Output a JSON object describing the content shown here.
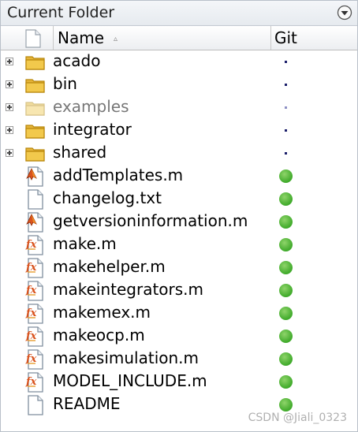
{
  "panel": {
    "title": "Current Folder"
  },
  "columns": {
    "name": "Name",
    "sort_indicator": "▵",
    "git": "Git"
  },
  "rows": [
    {
      "name": "acado",
      "type": "folder",
      "expandable": true,
      "dim": false,
      "git": "dot"
    },
    {
      "name": "bin",
      "type": "folder",
      "expandable": true,
      "dim": false,
      "git": "dot"
    },
    {
      "name": "examples",
      "type": "folder",
      "expandable": true,
      "dim": true,
      "git": "dot"
    },
    {
      "name": "integrator",
      "type": "folder",
      "expandable": true,
      "dim": false,
      "git": "dot"
    },
    {
      "name": "shared",
      "type": "folder",
      "expandable": true,
      "dim": false,
      "git": "dot"
    },
    {
      "name": "addTemplates.m",
      "type": "script",
      "expandable": false,
      "dim": false,
      "git": "green"
    },
    {
      "name": "changelog.txt",
      "type": "text",
      "expandable": false,
      "dim": false,
      "git": "green"
    },
    {
      "name": "getversioninformation.m",
      "type": "script",
      "expandable": false,
      "dim": false,
      "git": "green"
    },
    {
      "name": "make.m",
      "type": "function",
      "expandable": false,
      "dim": false,
      "git": "green"
    },
    {
      "name": "makehelper.m",
      "type": "function",
      "expandable": false,
      "dim": false,
      "git": "green"
    },
    {
      "name": "makeintegrators.m",
      "type": "function",
      "expandable": false,
      "dim": false,
      "git": "green"
    },
    {
      "name": "makemex.m",
      "type": "function",
      "expandable": false,
      "dim": false,
      "git": "green"
    },
    {
      "name": "makeocp.m",
      "type": "function",
      "expandable": false,
      "dim": false,
      "git": "green"
    },
    {
      "name": "makesimulation.m",
      "type": "function",
      "expandable": false,
      "dim": false,
      "git": "green"
    },
    {
      "name": "MODEL_INCLUDE.m",
      "type": "function",
      "expandable": false,
      "dim": false,
      "git": "green"
    },
    {
      "name": "README",
      "type": "text",
      "expandable": false,
      "dim": false,
      "git": "green"
    }
  ],
  "watermark": "CSDN @Jiali_0323",
  "colors": {
    "git_clean": "#3faa2a",
    "git_untracked": "#1b1f6a",
    "folder": "#f2c94c"
  },
  "icons": {
    "folder": "folder-icon",
    "script": "matlab-script-icon",
    "function": "matlab-function-icon",
    "text": "text-file-icon",
    "menu": "panel-menu-icon",
    "header": "file-type-column-icon"
  }
}
